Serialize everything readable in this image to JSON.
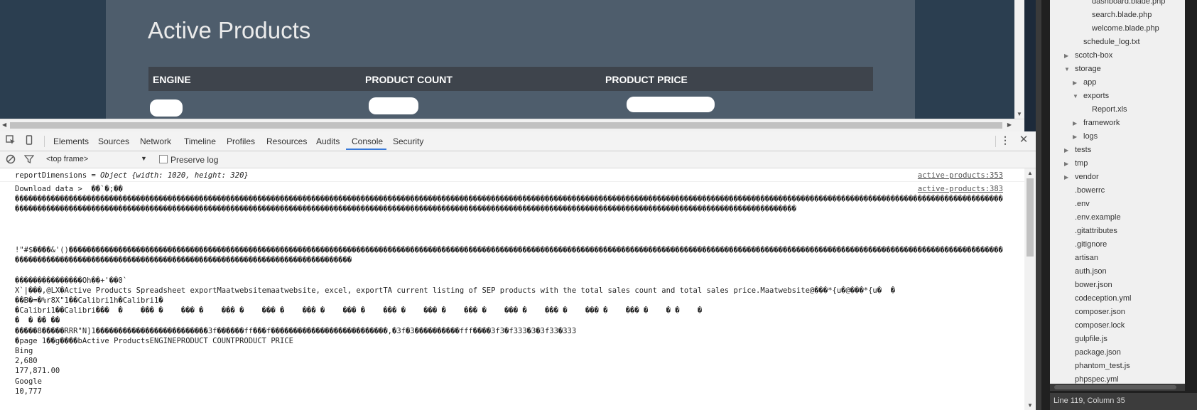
{
  "page": {
    "title": "Active Products",
    "table_headers": [
      "ENGINE",
      "PRODUCT COUNT",
      "PRODUCT PRICE"
    ]
  },
  "devtools": {
    "tabs": [
      "Elements",
      "Sources",
      "Network",
      "Timeline",
      "Profiles",
      "Resources",
      "Audits",
      "Console",
      "Security"
    ],
    "active_tab": "Console",
    "frame_select": "<top frame>",
    "preserve_log_label": "Preserve log",
    "console": {
      "line1_label": "reportDimensions = ",
      "line1_object": "Object {width: 1020, height: 320}",
      "line1_source": "active-products:353",
      "line2_label": "Download data >  ��`�;��",
      "line2_source": "active-products:383",
      "garbled_block_1": "����������������������������������������������������������������������������������������������������������������������������������������������������������������������������������������������������������������������������������������������������������������������������������������������������������������������������������������������������������������������������������������������������������",
      "garbled_block_2_start": "!\"#$����&'()",
      "garbled_block_2": "�������������������������������������������������������������������������������������������������������������������������������������������������������������������������������������������������������������������������������������������������������������������������������������������",
      "garbled_block_2_end": "���������������Oh��+'��0`",
      "excel_line_1": "X`|���,@LX�Active Products Spreadsheet exportMaatwebsitemaatwebsite, excel, exportTA current listing of SEP products with the total sales count and total sales price.Maatwebsite@���*{u�@���*{u�  �",
      "excel_line_2": "��B�=�%r8X\"1��Calibri1h�Calibri1�",
      "excel_line_3": "�Calibri1��Calibri���  �    ��� �    ��� �    ��� �    ��� �    ��� �    ��� �    ��� �    ��� �    ��� �    ��� �    ��� �    ��� �    ��� �    � �    �",
      "excel_line_4": "�  � �� ��",
      "excel_line_5": "�����8�����RRR\"N]1�������������������������3f������ff���f��������������������������,�3f�3����������fff����3f3�f333�3�3f33�333",
      "excel_line_6": "�page 1��g����bActive ProductsENGINEPRODUCT COUNTPRODUCT PRICE",
      "data_lines": [
        "Bing",
        "2,680",
        "177,871.00",
        "Google",
        "10,777"
      ]
    }
  },
  "file_tree": [
    {
      "label": "dashboard.blade.php",
      "depth": 4,
      "arrow": ""
    },
    {
      "label": "search.blade.php",
      "depth": 4,
      "arrow": ""
    },
    {
      "label": "welcome.blade.php",
      "depth": 4,
      "arrow": ""
    },
    {
      "label": "schedule_log.txt",
      "depth": 3,
      "arrow": ""
    },
    {
      "label": "scotch-box",
      "depth": 2,
      "arrow": "right"
    },
    {
      "label": "storage",
      "depth": 2,
      "arrow": "down"
    },
    {
      "label": "app",
      "depth": 3,
      "arrow": "right"
    },
    {
      "label": "exports",
      "depth": 3,
      "arrow": "down"
    },
    {
      "label": "Report.xls",
      "depth": 4,
      "arrow": ""
    },
    {
      "label": "framework",
      "depth": 3,
      "arrow": "right"
    },
    {
      "label": "logs",
      "depth": 3,
      "arrow": "right"
    },
    {
      "label": "tests",
      "depth": 2,
      "arrow": "right"
    },
    {
      "label": "tmp",
      "depth": 2,
      "arrow": "right"
    },
    {
      "label": "vendor",
      "depth": 2,
      "arrow": "right"
    },
    {
      "label": ".bowerrc",
      "depth": 2,
      "arrow": ""
    },
    {
      "label": ".env",
      "depth": 2,
      "arrow": ""
    },
    {
      "label": ".env.example",
      "depth": 2,
      "arrow": ""
    },
    {
      "label": ".gitattributes",
      "depth": 2,
      "arrow": ""
    },
    {
      "label": ".gitignore",
      "depth": 2,
      "arrow": ""
    },
    {
      "label": "artisan",
      "depth": 2,
      "arrow": ""
    },
    {
      "label": "auth.json",
      "depth": 2,
      "arrow": ""
    },
    {
      "label": "bower.json",
      "depth": 2,
      "arrow": ""
    },
    {
      "label": "codeception.yml",
      "depth": 2,
      "arrow": ""
    },
    {
      "label": "composer.json",
      "depth": 2,
      "arrow": ""
    },
    {
      "label": "composer.lock",
      "depth": 2,
      "arrow": ""
    },
    {
      "label": "gulpfile.js",
      "depth": 2,
      "arrow": ""
    },
    {
      "label": "package.json",
      "depth": 2,
      "arrow": ""
    },
    {
      "label": "phantom_test.js",
      "depth": 2,
      "arrow": ""
    },
    {
      "label": "phpspec.yml",
      "depth": 2,
      "arrow": ""
    }
  ],
  "status_bar": "Line 119, Column 35"
}
